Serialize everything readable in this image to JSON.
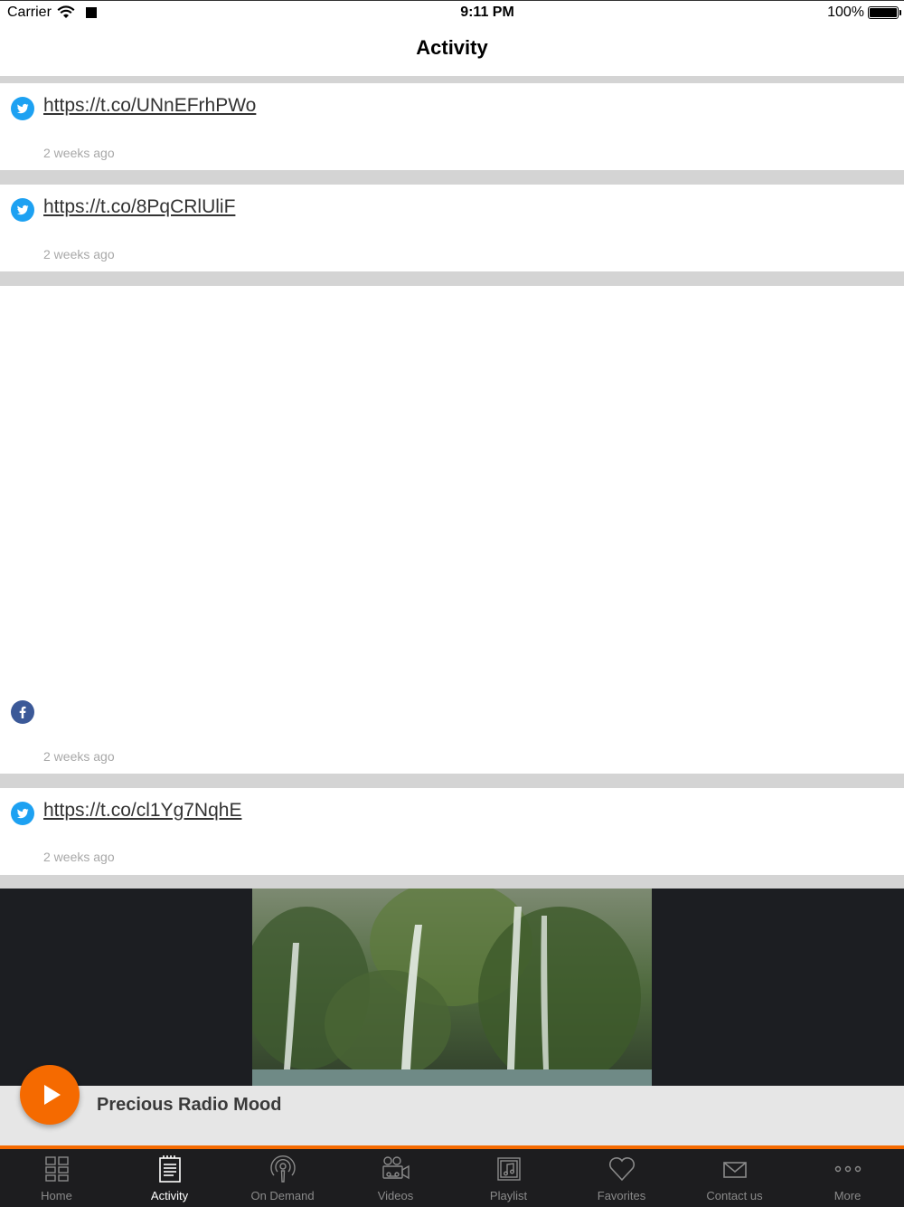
{
  "status_bar": {
    "carrier": "Carrier",
    "time": "9:11 PM",
    "battery": "100%"
  },
  "nav": {
    "title": "Activity"
  },
  "feed": [
    {
      "source": "twitter-icon",
      "link": "https://t.co/UNnEFrhPWo",
      "time": "2 weeks ago"
    },
    {
      "source": "twitter-icon",
      "link": "https://t.co/8PqCRlUliF",
      "time": "2 weeks ago"
    },
    {
      "source": "facebook-icon",
      "link": "",
      "time": "2 weeks ago"
    },
    {
      "source": "twitter-icon",
      "link": "https://t.co/cl1Yg7NqhE",
      "time": "2 weeks ago"
    }
  ],
  "player": {
    "title": "Precious Radio Mood"
  },
  "tabs": [
    {
      "label": "Home",
      "icon": "grid-icon",
      "active": false
    },
    {
      "label": "Activity",
      "icon": "notepad-icon",
      "active": true
    },
    {
      "label": "On Demand",
      "icon": "podcast-icon",
      "active": false
    },
    {
      "label": "Videos",
      "icon": "video-camera-icon",
      "active": false
    },
    {
      "label": "Playlist",
      "icon": "music-note-icon",
      "active": false
    },
    {
      "label": "Favorites",
      "icon": "heart-icon",
      "active": false
    },
    {
      "label": "Contact us",
      "icon": "envelope-icon",
      "active": false
    },
    {
      "label": "More",
      "icon": "more-dots-icon",
      "active": false
    }
  ],
  "colors": {
    "accent": "#f56a00",
    "twitter": "#1da1f2",
    "facebook": "#3b5998",
    "tabbar": "#1d1d1f"
  }
}
